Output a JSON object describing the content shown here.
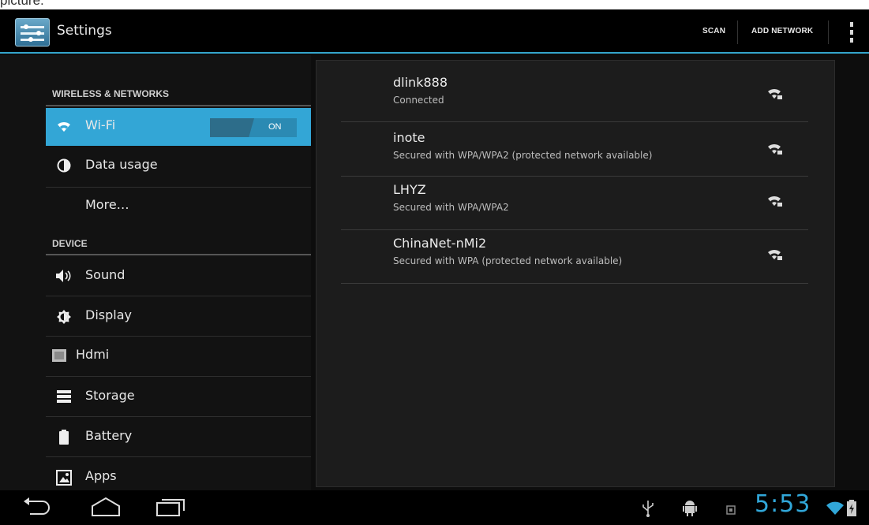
{
  "caption": "picture.",
  "actionbar": {
    "title": "Settings",
    "scan_label": "SCAN",
    "add_network_label": "ADD NETWORK",
    "app_icon": "settings-sliders-icon",
    "overflow_icon": "overflow-menu-icon"
  },
  "sidebar": {
    "sections": [
      {
        "header": "WIRELESS & NETWORKS"
      },
      {
        "header": "DEVICE"
      }
    ],
    "items": [
      {
        "label": "Wi-Fi",
        "icon": "wifi-icon",
        "selected": true
      },
      {
        "label": "Data usage",
        "icon": "data-usage-icon"
      },
      {
        "label": "More…",
        "icon": ""
      },
      {
        "label": "Sound",
        "icon": "sound-icon"
      },
      {
        "label": "Display",
        "icon": "display-icon"
      },
      {
        "label": "Hdmi",
        "icon": "hdmi-icon"
      },
      {
        "label": "Storage",
        "icon": "storage-icon"
      },
      {
        "label": "Battery",
        "icon": "battery-icon"
      },
      {
        "label": "Apps",
        "icon": "apps-icon"
      }
    ],
    "wifi_switch": "ON"
  },
  "networks": [
    {
      "ssid": "dlink888",
      "status": "Connected",
      "icon": "wifi-signal-locked-icon"
    },
    {
      "ssid": "inote",
      "status": "Secured with WPA/WPA2 (protected network available)",
      "icon": "wifi-signal-locked-icon"
    },
    {
      "ssid": "LHYZ",
      "status": "Secured with WPA/WPA2",
      "icon": "wifi-signal-locked-icon"
    },
    {
      "ssid": "ChinaNet-nMi2",
      "status": "Secured with WPA (protected network available)",
      "icon": "wifi-signal-locked-icon"
    }
  ],
  "navbar": {
    "time": "5:53",
    "buttons": [
      "back-icon",
      "home-icon",
      "recent-apps-icon"
    ],
    "tray_icons": [
      "usb-icon",
      "android-debug-icon",
      "notification-icon",
      "wifi-status-icon",
      "battery-status-icon"
    ]
  },
  "colors": {
    "accent": "#33a6d6",
    "background": "#0d0d0d",
    "panel": "#1c1c1c"
  }
}
